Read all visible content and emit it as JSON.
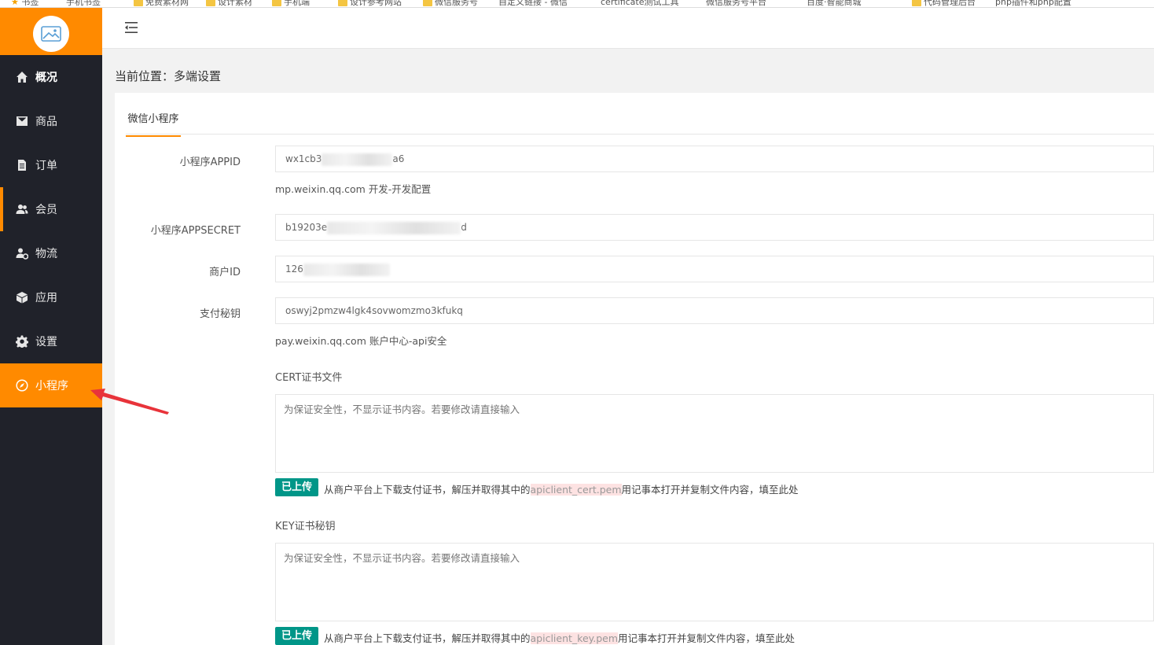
{
  "bookmarks": [
    "书签",
    "手机书签",
    "免费素材网",
    "设计素材",
    "手机端",
    "设计参考网站",
    "微信服务号",
    "自定义链接 - 微信",
    "certificate测试工具",
    "微信服务号平台",
    "百度·智能商城",
    "代码管理后台",
    "php插件和php配置"
  ],
  "sidebar": {
    "items": [
      {
        "label": "概况",
        "icon": "home-icon"
      },
      {
        "label": "商品",
        "icon": "mail-icon"
      },
      {
        "label": "订单",
        "icon": "document-icon"
      },
      {
        "label": "会员",
        "icon": "users-icon"
      },
      {
        "label": "物流",
        "icon": "user-gear-icon"
      },
      {
        "label": "应用",
        "icon": "cube-icon"
      },
      {
        "label": "设置",
        "icon": "gear-icon"
      },
      {
        "label": "小程序",
        "icon": "compass-icon"
      }
    ]
  },
  "breadcrumb": "当前位置：多端设置",
  "tab": "微信小程序",
  "form": {
    "appid_label": "小程序APPID",
    "appid_prefix": "wx1cb3",
    "appid_suffix": "a6",
    "appid_hint": "mp.weixin.qq.com 开发-开发配置",
    "secret_label": "小程序APPSECRET",
    "secret_prefix": "b19203e",
    "secret_suffix": "d",
    "merchant_label": "商户ID",
    "merchant_prefix": "126",
    "paykey_label": "支付秘钥",
    "paykey_value": "oswyj2pmzw4lgk4sovwomzmo3kfukq",
    "paykey_hint": "pay.weixin.qq.com 账户中心-api安全",
    "cert_label": "CERT证书文件",
    "cert_placeholder": "为保证安全性，不显示证书内容。若要修改请直接输入",
    "cert_badge": "已上传",
    "cert_hint_before": "从商户平台上下载支付证书，解压并取得其中的",
    "cert_file": "apiclient_cert.pem",
    "cert_hint_after": "用记事本打开并复制文件内容，填至此处",
    "key_label": "KEY证书秘钥",
    "key_placeholder": "为保证安全性，不显示证书内容。若要修改请直接输入",
    "key_badge": "已上传",
    "key_hint_before": "从商户平台上下载支付证书，解压并取得其中的",
    "key_file": "apiclient_key.pem",
    "key_hint_after": "用记事本打开并复制文件内容，填至此处"
  },
  "colors": {
    "accent": "#ff8a00",
    "sidebar": "#20222a",
    "badge": "#009688",
    "arrow": "#e8333a"
  }
}
